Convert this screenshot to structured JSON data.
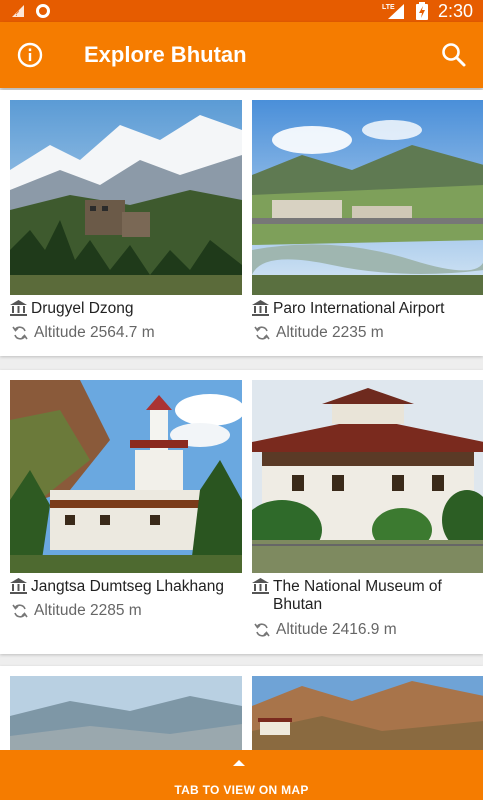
{
  "status_bar": {
    "time": "2:30",
    "network": "LTE"
  },
  "app_bar": {
    "title": "Explore Bhutan"
  },
  "places": [
    {
      "name": "Drugyel Dzong",
      "altitude": "Altitude 2564.7 m"
    },
    {
      "name": "Paro International Airport",
      "altitude": "Altitude 2235 m"
    },
    {
      "name": "Jangtsa Dumtseg Lhakhang",
      "altitude": "Altitude 2285 m"
    },
    {
      "name": "The National Museum of Bhutan",
      "altitude": "Altitude 2416.9 m"
    }
  ],
  "map_bar": {
    "label": "TAB TO VIEW ON MAP"
  },
  "colors": {
    "primary": "#f57c00",
    "status": "#e65c00"
  }
}
